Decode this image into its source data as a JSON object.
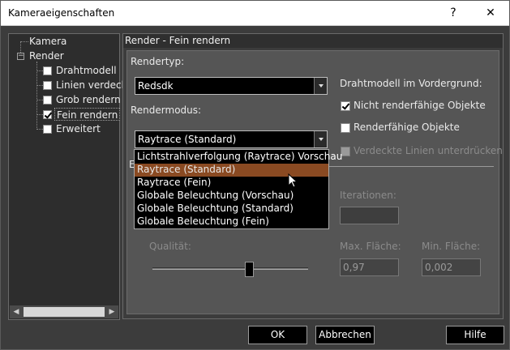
{
  "window": {
    "title": "Kameraeigenschaften",
    "help_glyph": "?",
    "close_glyph": "✕"
  },
  "tree": {
    "items": [
      {
        "label": "Kamera"
      },
      {
        "label": "Render",
        "expand": "−"
      },
      {
        "label": "Drahtmodell",
        "checked": false
      },
      {
        "label": "Linien verdeck",
        "checked": false
      },
      {
        "label": "Grob rendern",
        "checked": false
      },
      {
        "label": "Fein rendern",
        "checked": true
      },
      {
        "label": "Erweitert",
        "checked": false
      }
    ],
    "scroll_left": "◀",
    "scroll_right": "▶"
  },
  "panel": {
    "header": "Render - Fein rendern",
    "render_type_label": "Rendertyp:",
    "render_type_value": "Redsdk",
    "render_mode_label": "Rendermodus:",
    "render_mode_value": "Raytrace (Standard)",
    "wireframe_label": "Drahtmodell im Vordergrund:",
    "cb_non_renderable": "Nicht renderfähige Objekte",
    "cb_renderable": "Renderfähige Objekte",
    "cb_hidden_lines": "Verdeckte Linien unterdrücken",
    "group_initial": "E",
    "iterations_label": "Iterationen:",
    "quality_label": "Qualität:",
    "max_area_label": "Max. Fläche:",
    "min_area_label": "Min. Fläche:",
    "max_area_value": "0,97",
    "min_area_value": "0,002",
    "quality_level": 0.63
  },
  "dropdown": {
    "options": [
      "Lichtstrahlverfolgung (Raytrace) Vorschau",
      "Raytrace (Standard)",
      "Raytrace (Fein)",
      "Globale Beleuchtung (Vorschau)",
      "Globale Beleuchtung (Standard)",
      "Globale Beleuchtung (Fein)"
    ],
    "selected_index": 1
  },
  "buttons": {
    "ok": "OK",
    "cancel": "Abbrechen",
    "help": "Hilfe"
  },
  "colors": {
    "highlight": "#8a4a22",
    "background": "#3c3c3c"
  }
}
